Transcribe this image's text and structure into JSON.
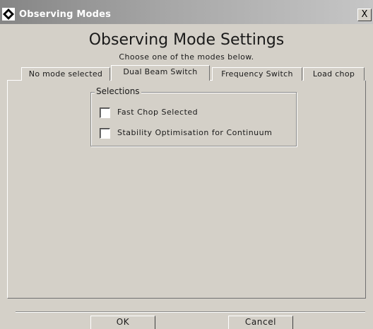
{
  "window": {
    "title": "Observing Modes",
    "close_glyph": "X",
    "icon": "diamond-app-icon"
  },
  "header": {
    "title": "Observing Mode Settings",
    "subtitle": "Choose one of the modes below."
  },
  "tabs": [
    {
      "label": "No mode selected",
      "selected": false
    },
    {
      "label": "Dual Beam Switch",
      "selected": true
    },
    {
      "label": "Frequency Switch",
      "selected": false
    },
    {
      "label": "Load chop",
      "selected": false
    }
  ],
  "selections": {
    "title": "Selections",
    "options": [
      {
        "label": "Fast Chop Selected",
        "checked": false
      },
      {
        "label": "Stability Optimisation for Continuum",
        "checked": false
      }
    ]
  },
  "buttons": {
    "ok": "OK",
    "cancel": "Cancel"
  },
  "colors": {
    "window_background": "#d4d0c8",
    "title_bar_start": "#858585",
    "title_bar_end": "#c6c6c6"
  }
}
